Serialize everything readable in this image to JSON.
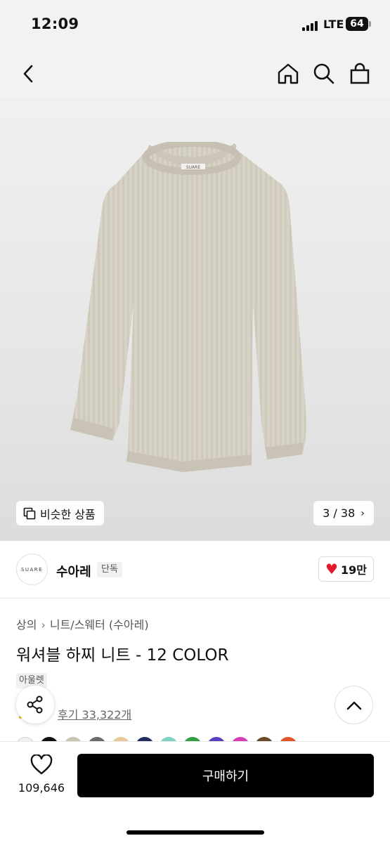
{
  "status_bar": {
    "time": "12:09",
    "network": "LTE",
    "battery": "64"
  },
  "header": {
    "icons": [
      "back-arrow-icon",
      "home-icon",
      "search-icon",
      "shopping-bag-icon"
    ]
  },
  "hero": {
    "similar_button_label": "비슷한 상품",
    "image_counter": "3 / 38",
    "image_text": "SUARE"
  },
  "brand": {
    "logo_text": "SUARE",
    "name": "수아레",
    "badge": "단독",
    "like_count": "19만"
  },
  "product": {
    "breadcrumb": [
      "상의",
      "니트/스웨터 (수아레)"
    ],
    "title": "워셔블 하찌 니트 - 12 COLOR",
    "tag": "아울렛",
    "review_text": "후기 33,322개"
  },
  "colors": {
    "swatches": [
      "#f2f2f2",
      "#111111",
      "#c9c3b0",
      "#6b6b6b",
      "#e8c99a",
      "#1f2f5a",
      "#7fd1c2",
      "#2f9e44",
      "#5a3fbf",
      "#d43fb5",
      "#6b4a2a",
      "#e2552a"
    ]
  },
  "bottom_bar": {
    "favorite_count": "109,646",
    "buy_label": "구매하기"
  }
}
